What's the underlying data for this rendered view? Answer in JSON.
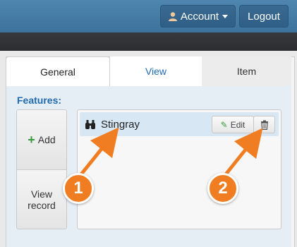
{
  "header": {
    "account_label": "Account",
    "logout_label": "Logout"
  },
  "tabs": [
    {
      "label": "General",
      "active": true
    },
    {
      "label": "View",
      "active": false
    },
    {
      "label": "Item",
      "active": false
    }
  ],
  "features": {
    "label": "Features:",
    "add_label": "Add",
    "view_record_label": "View record",
    "items": [
      {
        "label": "Stingray",
        "edit_label": "Edit"
      }
    ]
  },
  "callouts": [
    {
      "number": "1"
    },
    {
      "number": "2"
    }
  ],
  "colors": {
    "header": "#3c729b",
    "accent": "#1f6ab0",
    "callout": "#f07d22",
    "selected_row": "#d7e7f3"
  },
  "icons": {
    "account": "user-icon",
    "add": "plus-icon",
    "row": "binoculars-icon",
    "edit": "pencil-icon",
    "delete": "trash-icon"
  }
}
